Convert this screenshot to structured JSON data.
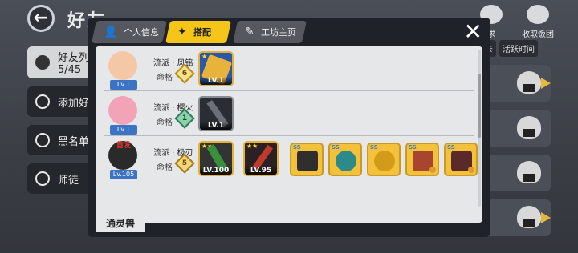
{
  "page": {
    "title": "好友"
  },
  "top_icons": [
    {
      "name": "friend-requests-icon",
      "label": "求"
    },
    {
      "name": "collect-rice-icon",
      "label": "收取饭团"
    }
  ],
  "sidebar": {
    "items": [
      {
        "label": "好友列表",
        "sub": "5/45"
      },
      {
        "label": "添加好友"
      },
      {
        "label": "黑名单"
      },
      {
        "label": "师徒"
      }
    ]
  },
  "right_panel": {
    "sort_labels": [
      "亲",
      "活跃时间"
    ]
  },
  "modal": {
    "tabs": [
      {
        "label": "个人信息",
        "icon": "profile-icon"
      },
      {
        "label": "搭配",
        "icon": "shuriken-icon",
        "active": true
      },
      {
        "label": "工坊主页",
        "icon": "pencil-icon"
      }
    ],
    "rows": [
      {
        "school": "流派 · 风铭",
        "rank_label": "命格",
        "rank_value": "6",
        "lv": "Lv.1",
        "avatar_color": "#f4c7a6",
        "weapon": {
          "lv": "LV.1",
          "color": "#e9b33b"
        }
      },
      {
        "school": "流派 · 樱火",
        "rank_label": "命格",
        "rank_value": "1",
        "lv": "Lv.1",
        "avatar_color": "#f3a3b8",
        "weapon": {
          "lv": "LV.1",
          "color": "#6b6f78"
        }
      },
      {
        "school": "流派 · 极刃",
        "rank_label": "命格",
        "rank_value": "5",
        "lv": "Lv.105",
        "avatar_color": "#2a2a2a",
        "badge": "首发",
        "weapon": {
          "lv": "LV.100",
          "color": "#3a8f3a"
        },
        "weapon2": {
          "lv": "LV.95",
          "color": "#c03a2a"
        },
        "equips": [
          {
            "color": "#2f2f2f"
          },
          {
            "color": "#2d8a8a"
          },
          {
            "color": "#d49a1a"
          },
          {
            "color": "#a8452e"
          },
          {
            "color": "#5a2a2a"
          }
        ]
      }
    ],
    "section_label": "通灵兽",
    "close_icon": "close-icon"
  }
}
